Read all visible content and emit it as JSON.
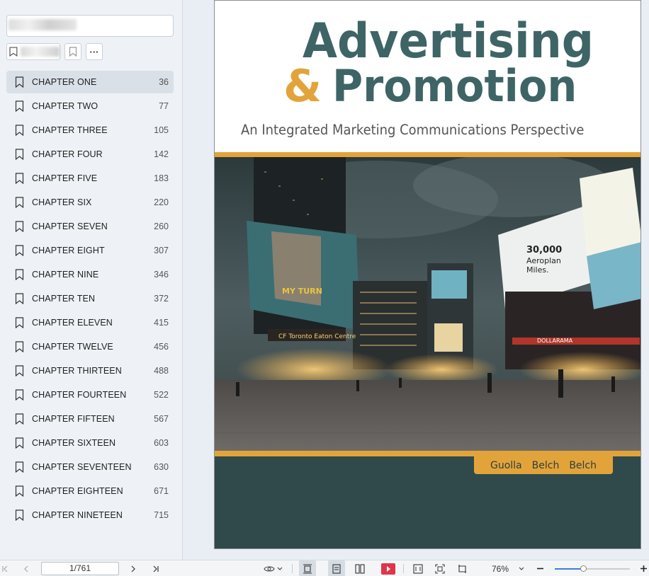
{
  "sidebar": {
    "search_placeholder": "",
    "more_label": "···",
    "items": [
      {
        "label": "CHAPTER ONE",
        "page": "36"
      },
      {
        "label": "CHAPTER TWO",
        "page": "77"
      },
      {
        "label": "CHAPTER THREE",
        "page": "105"
      },
      {
        "label": "CHAPTER FOUR",
        "page": "142"
      },
      {
        "label": "CHAPTER FIVE",
        "page": "183"
      },
      {
        "label": "CHAPTER SIX",
        "page": "220"
      },
      {
        "label": "CHAPTER SEVEN",
        "page": "260"
      },
      {
        "label": "CHAPTER EIGHT",
        "page": "307"
      },
      {
        "label": "CHAPTER NINE",
        "page": "346"
      },
      {
        "label": "CHAPTER TEN",
        "page": "372"
      },
      {
        "label": "CHAPTER ELEVEN",
        "page": "415"
      },
      {
        "label": "CHAPTER TWELVE",
        "page": "456"
      },
      {
        "label": "CHAPTER THIRTEEN",
        "page": "488"
      },
      {
        "label": "CHAPTER FOURTEEN",
        "page": "522"
      },
      {
        "label": "CHAPTER FIFTEEN",
        "page": "567"
      },
      {
        "label": "CHAPTER SIXTEEN",
        "page": "603"
      },
      {
        "label": "CHAPTER SEVENTEEN",
        "page": "630"
      },
      {
        "label": "CHAPTER EIGHTEEN",
        "page": "671"
      },
      {
        "label": "CHAPTER NINETEEN",
        "page": "715"
      }
    ]
  },
  "cover": {
    "title_line1": "Advertising",
    "ampersand": "&",
    "title_line2": "Promotion",
    "subtitle": "An Integrated Marketing Communications Perspective",
    "authors": [
      "Guolla",
      "Belch",
      "Belch"
    ],
    "colors": {
      "teal": "#3e6466",
      "orange": "#e2a43a",
      "dark_teal": "#30494a"
    }
  },
  "statusbar": {
    "page_indicator": "1/761",
    "zoom": "76%",
    "zoom_fraction": 0.38
  }
}
